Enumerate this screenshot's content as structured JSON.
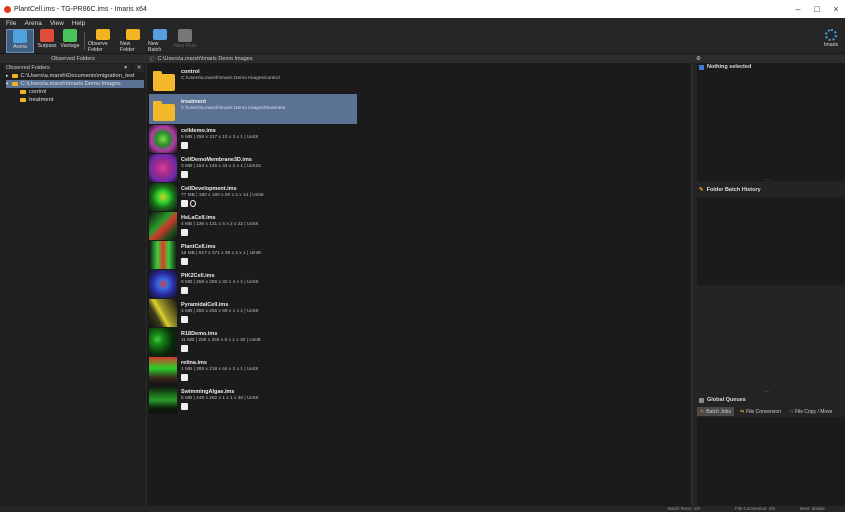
{
  "window": {
    "title": "PlantCell.ims - TG-PR86C.ims - Imaris x64",
    "minimize": "–",
    "maximize": "□",
    "close": "×"
  },
  "menu": [
    "File",
    "Arena",
    "View",
    "Help"
  ],
  "toolbar": {
    "buttons": [
      {
        "label": "Arena",
        "color": "#4fa3e0",
        "active": true
      },
      {
        "label": "Surpass",
        "color": "#e04b3a",
        "active": false
      },
      {
        "label": "Vantage",
        "color": "#4cc35a",
        "active": false
      },
      {
        "label": "Observe Folder",
        "color": "#f2b423",
        "active": false
      },
      {
        "label": "New Folder",
        "color": "#f2b423",
        "active": false
      },
      {
        "label": "New Batch",
        "color": "#5aa0e0",
        "active": false
      },
      {
        "label": "New Fluo",
        "color": "#777777",
        "active": false
      }
    ],
    "brand": "Imaris"
  },
  "left_panel": {
    "header": "Observed Folders",
    "dropdown_label": "Observed Folders",
    "tree": [
      {
        "label": "C:\\Users\\a.marsh\\Documents\\migration_test",
        "level": 0,
        "selected": false
      },
      {
        "label": "C:\\Users\\a.marsh\\Imaris Demo Images",
        "level": 0,
        "selected": true
      },
      {
        "label": "control",
        "level": 1,
        "selected": false
      },
      {
        "label": "treatment",
        "level": 1,
        "selected": false
      }
    ]
  },
  "center_panel": {
    "path": "C:\\Users\\a.marsh\\Imaris Demo Images",
    "folders": [
      {
        "name": "control",
        "path": "C:\\Users\\a.marsh\\Imaris Demo Images\\control",
        "selected": false
      },
      {
        "name": "treatment",
        "path": "C:\\Users\\a.marsh\\Imaris Demo Images\\treatment",
        "selected": true
      }
    ],
    "files": [
      {
        "name": "celldemo.ims",
        "meta": "5 MB | 256 x 317 x 10 x 3 x 1 | Uint8",
        "colors": [
          "#2a8a2a",
          "#7ae04a",
          "#b23aa8"
        ]
      },
      {
        "name": "CellDemoMembrane3D.ims",
        "meta": "3 MB | 154 x 146 x 44 x 2 x 1 | Uint16",
        "colors": [
          "#e03aa0",
          "#9a2a8a",
          "#6a2aaa"
        ]
      },
      {
        "name": "CellDevelopment.ims",
        "meta": "77 MB | 180 x 180 x 90 x 2 x 14 | Uint8",
        "colors": [
          "#2ad02a",
          "#e0d02a",
          "#1a6a1a"
        ]
      },
      {
        "name": "HeLaCell.ims",
        "meta": "4 MB | 136 x 131 x 5 x 2 x 22 | Uint8",
        "colors": [
          "#2a9a2a",
          "#d03a2a",
          "#1a4a1a"
        ]
      },
      {
        "name": "PlantCell.ims",
        "meta": "16 MB | 617 x 371 x 38 x 2 x 1 | Uint8",
        "colors": [
          "#3ad03a",
          "#e03a2a",
          "#2a2a2a"
        ]
      },
      {
        "name": "PtK2Cell.ims",
        "meta": "8 MB | 256 x 256 x 32 x 4 x 1 | Uint8",
        "colors": [
          "#3a6ae0",
          "#2a2aa0",
          "#e03a3a"
        ]
      },
      {
        "name": "PyramidalCell.ims",
        "meta": "4 MB | 255 x 255 x 69 x 1 x 1 | Uint8",
        "colors": [
          "#e0d02a",
          "#a09a2a",
          "#3a3a1a"
        ]
      },
      {
        "name": "R18Demo.ims",
        "meta": "11 MB | 256 x 256 x 6 x 1 x 30 | Uint8",
        "colors": [
          "#1a8a1a",
          "#3ad03a",
          "#0a2a0a"
        ]
      },
      {
        "name": "retina.ims",
        "meta": "1 MB | 285 x 218 x 64 x 2 x 1 | Uint8",
        "colors": [
          "#d03a2a",
          "#2ad02a",
          "#3a2a1a"
        ]
      },
      {
        "name": "SwimmingAlgae.ims",
        "meta": "5 MB | 448 x 262 x 1 x 1 x 45 | Uint8",
        "colors": [
          "#1a6a1a",
          "#2a9a2a",
          "#0a1a0a"
        ]
      }
    ]
  },
  "right_panel": {
    "selection": "Nothing selected",
    "history": "Folder Batch History",
    "queues": "Global Queues",
    "tabs": [
      "Batch Jobs",
      "File Conversion",
      "File Copy / Move"
    ],
    "dots": "..."
  },
  "statusbar": {
    "items": [
      "Batch Runs: 1/5",
      "File Conversion: 1/5",
      "Next: details"
    ]
  }
}
